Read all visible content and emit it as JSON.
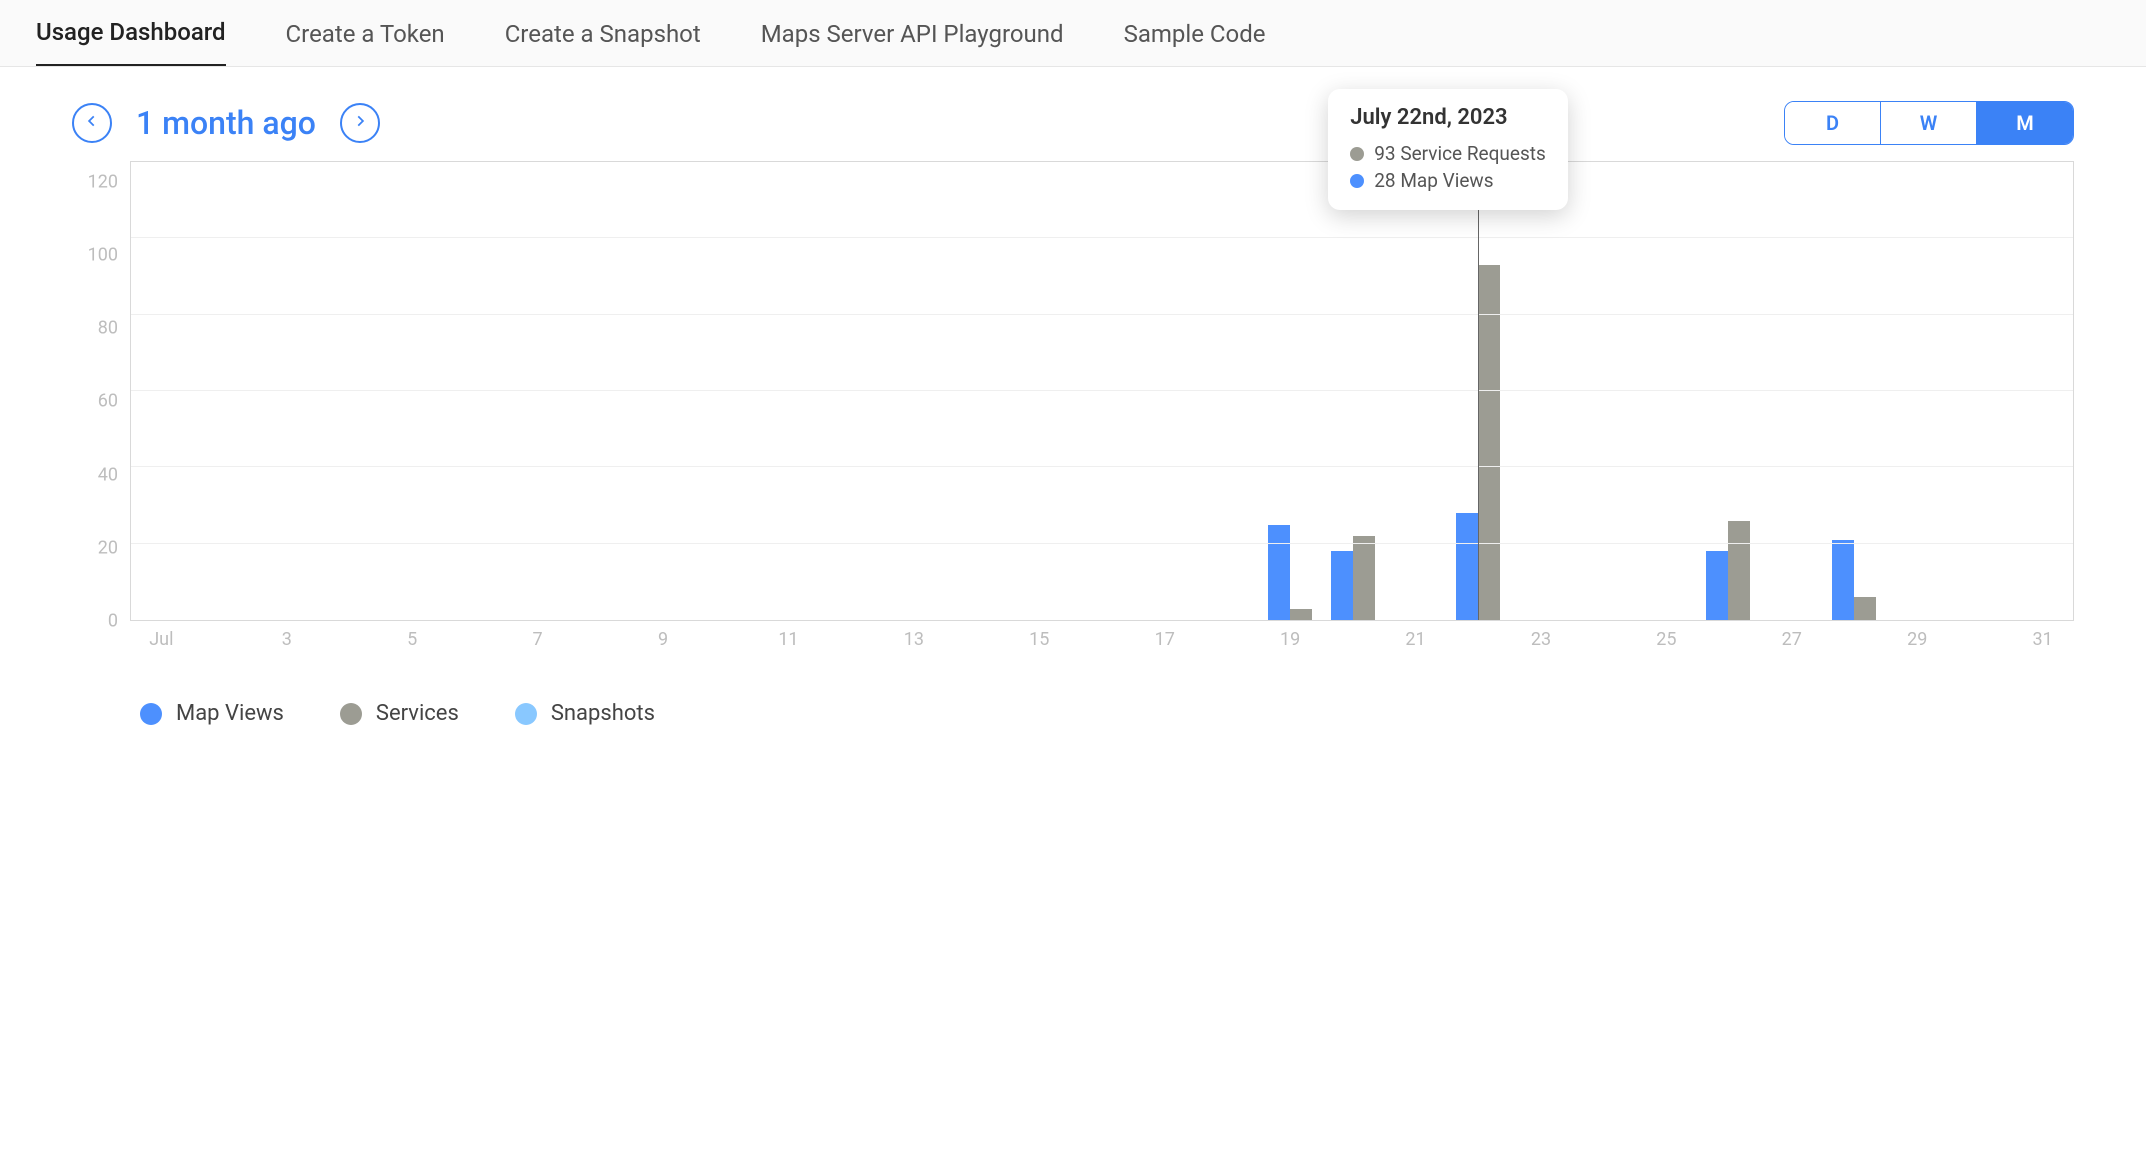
{
  "tabs": [
    {
      "label": "Usage Dashboard",
      "active": true
    },
    {
      "label": "Create a Token",
      "active": false
    },
    {
      "label": "Create a Snapshot",
      "active": false
    },
    {
      "label": "Maps Server API Playground",
      "active": false
    },
    {
      "label": "Sample Code",
      "active": false
    }
  ],
  "range": {
    "label": "1 month ago"
  },
  "segmented": [
    {
      "label": "D",
      "active": false
    },
    {
      "label": "W",
      "active": false
    },
    {
      "label": "M",
      "active": true
    }
  ],
  "tooltip": {
    "title": "July 22nd, 2023",
    "rows": [
      {
        "color": "#9c9c93",
        "text": "93 Service Requests"
      },
      {
        "color": "#4d90fe",
        "text": "28 Map Views"
      }
    ]
  },
  "legend": [
    {
      "color": "#4d90fe",
      "label": "Map Views"
    },
    {
      "color": "#9c9c93",
      "label": "Services"
    },
    {
      "color": "#89c8ff",
      "label": "Snapshots"
    }
  ],
  "colors": {
    "map_views": "#4d90fe",
    "services": "#9c9c93",
    "snapshots": "#89c8ff"
  },
  "chart_data": {
    "type": "bar",
    "title": "",
    "xlabel": "",
    "ylabel": "",
    "ylim": [
      0,
      120
    ],
    "yticks": [
      120,
      100,
      80,
      60,
      40,
      20,
      0
    ],
    "x_tick_labels": [
      "Jul",
      "3",
      "5",
      "7",
      "9",
      "11",
      "13",
      "15",
      "17",
      "19",
      "21",
      "23",
      "25",
      "27",
      "29",
      "31"
    ],
    "x_tick_positions": [
      1,
      3,
      5,
      7,
      9,
      11,
      13,
      15,
      17,
      19,
      21,
      23,
      25,
      27,
      29,
      31
    ],
    "categories": [
      1,
      2,
      3,
      4,
      5,
      6,
      7,
      8,
      9,
      10,
      11,
      12,
      13,
      14,
      15,
      16,
      17,
      18,
      19,
      20,
      21,
      22,
      23,
      24,
      25,
      26,
      27,
      28,
      29,
      30,
      31
    ],
    "series": [
      {
        "name": "Map Views",
        "values": [
          0,
          0,
          0,
          0,
          0,
          0,
          0,
          0,
          0,
          0,
          0,
          0,
          0,
          0,
          0,
          0,
          0,
          0,
          25,
          18,
          0,
          28,
          0,
          0,
          0,
          18,
          0,
          21,
          0,
          0,
          0
        ]
      },
      {
        "name": "Services",
        "values": [
          0,
          0,
          0,
          0,
          0,
          0,
          0,
          0,
          0,
          0,
          0,
          0,
          0,
          0,
          0,
          0,
          0,
          0,
          3,
          22,
          0,
          93,
          0,
          0,
          0,
          26,
          0,
          6,
          0,
          0,
          0
        ]
      },
      {
        "name": "Snapshots",
        "values": [
          0,
          0,
          0,
          0,
          0,
          0,
          0,
          0,
          0,
          0,
          0,
          0,
          0,
          0,
          0,
          0,
          0,
          0,
          0,
          0,
          0,
          0,
          0,
          0,
          0,
          0,
          0,
          0,
          0,
          0,
          0
        ]
      }
    ],
    "hover_index": 21
  }
}
